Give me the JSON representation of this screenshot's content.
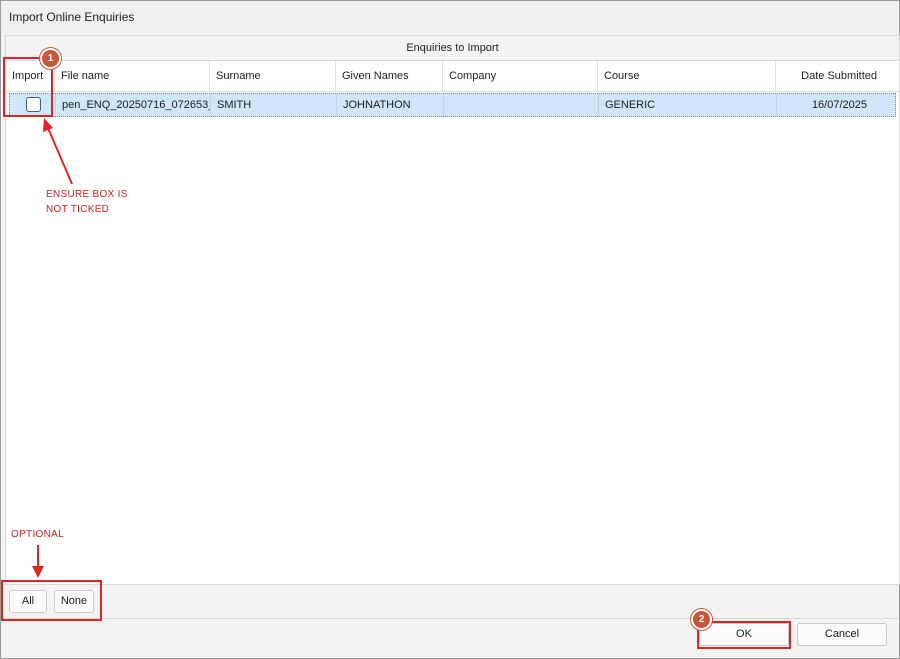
{
  "window": {
    "title": "Import Online Enquiries"
  },
  "panel": {
    "caption": "Enquiries to Import"
  },
  "grid": {
    "columns": [
      "Import",
      "File name",
      "Surname",
      "Given Names",
      "Company",
      "Course",
      "Date Submitted"
    ],
    "rows": [
      {
        "import_checked": false,
        "file_name": "pen_ENQ_20250716_072653_",
        "surname": "SMITH",
        "given_names": "JOHNATHON",
        "company": "",
        "course": "GENERIC",
        "date_submitted": "16/07/2025"
      }
    ]
  },
  "selection_buttons": {
    "all": "All",
    "none": "None"
  },
  "dialog_buttons": {
    "ok": "OK",
    "cancel": "Cancel"
  },
  "annotations": {
    "badge_1": "1",
    "badge_2": "2",
    "note_1_line1": "ENSURE BOX IS",
    "note_1_line2": "NOT TICKED",
    "optional": "OPTIONAL"
  },
  "colors": {
    "annotation": "#e02424",
    "badge": "#c9553a",
    "row_selected": "#cfe6fb"
  }
}
